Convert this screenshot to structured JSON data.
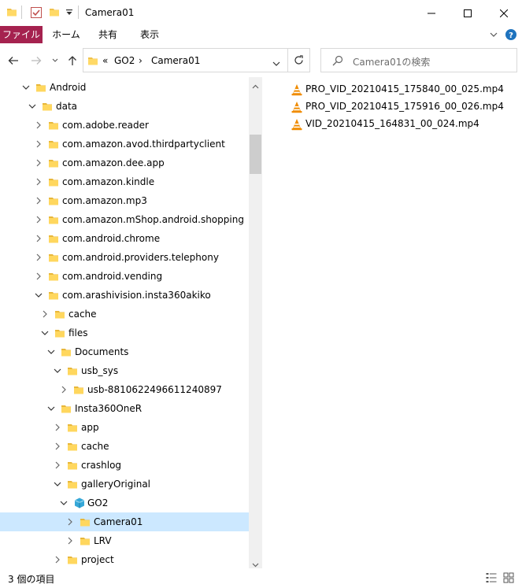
{
  "window": {
    "title": "Camera01",
    "minimize_glyph": "—",
    "maximize_glyph": "☐",
    "close_glyph": "✕"
  },
  "ribbon": {
    "tabs": [
      "ファイル",
      "ホーム",
      "共有",
      "表示"
    ],
    "expand_glyph": "∨",
    "help_glyph": "?"
  },
  "address": {
    "back_glyph": "←",
    "forward_glyph": "→",
    "recent_glyph": "∨",
    "up_glyph": "↑",
    "overflow": "«",
    "crumbs": [
      "GO2",
      "Camera01"
    ],
    "separator": "›",
    "dropdown_glyph": "∨",
    "refresh_glyph": "↻",
    "search_placeholder": "Camera01の検索"
  },
  "tree": [
    {
      "label": "Android",
      "depth": 0,
      "expanded": true,
      "icon": "folder-icon"
    },
    {
      "label": "data",
      "depth": 1,
      "expanded": true,
      "icon": "folder-icon"
    },
    {
      "label": "com.adobe.reader",
      "depth": 2,
      "expanded": false,
      "icon": "folder-icon"
    },
    {
      "label": "com.amazon.avod.thirdpartyclient",
      "depth": 2,
      "expanded": false,
      "icon": "folder-icon"
    },
    {
      "label": "com.amazon.dee.app",
      "depth": 2,
      "expanded": false,
      "icon": "folder-icon"
    },
    {
      "label": "com.amazon.kindle",
      "depth": 2,
      "expanded": false,
      "icon": "folder-icon"
    },
    {
      "label": "com.amazon.mp3",
      "depth": 2,
      "expanded": false,
      "icon": "folder-icon"
    },
    {
      "label": "com.amazon.mShop.android.shopping",
      "depth": 2,
      "expanded": false,
      "icon": "folder-icon"
    },
    {
      "label": "com.android.chrome",
      "depth": 2,
      "expanded": false,
      "icon": "folder-icon"
    },
    {
      "label": "com.android.providers.telephony",
      "depth": 2,
      "expanded": false,
      "icon": "folder-icon"
    },
    {
      "label": "com.android.vending",
      "depth": 2,
      "expanded": false,
      "icon": "folder-icon"
    },
    {
      "label": "com.arashivision.insta360akiko",
      "depth": 2,
      "expanded": true,
      "icon": "folder-icon"
    },
    {
      "label": "cache",
      "depth": 3,
      "expanded": false,
      "icon": "folder-icon"
    },
    {
      "label": "files",
      "depth": 3,
      "expanded": true,
      "icon": "folder-icon"
    },
    {
      "label": "Documents",
      "depth": 4,
      "expanded": true,
      "icon": "folder-icon"
    },
    {
      "label": "usb_sys",
      "depth": 5,
      "expanded": true,
      "icon": "folder-icon"
    },
    {
      "label": "usb-8810622496611240897",
      "depth": 6,
      "expanded": false,
      "icon": "folder-icon"
    },
    {
      "label": "Insta360OneR",
      "depth": 4,
      "expanded": true,
      "icon": "folder-icon"
    },
    {
      "label": "app",
      "depth": 5,
      "expanded": false,
      "icon": "folder-icon"
    },
    {
      "label": "cache",
      "depth": 5,
      "expanded": false,
      "icon": "folder-icon"
    },
    {
      "label": "crashlog",
      "depth": 5,
      "expanded": false,
      "icon": "folder-icon"
    },
    {
      "label": "galleryOriginal",
      "depth": 5,
      "expanded": true,
      "icon": "folder-icon"
    },
    {
      "label": "GO2",
      "depth": 6,
      "expanded": true,
      "icon": "3d-object-folder-icon"
    },
    {
      "label": "Camera01",
      "depth": 7,
      "expanded": false,
      "icon": "folder-icon",
      "selected": true
    },
    {
      "label": "LRV",
      "depth": 7,
      "expanded": false,
      "icon": "folder-icon"
    },
    {
      "label": "project",
      "depth": 5,
      "expanded": false,
      "icon": "folder-icon"
    }
  ],
  "files": [
    {
      "name": "PRO_VID_20210415_175840_00_025.mp4",
      "icon": "vlc-cone-icon"
    },
    {
      "name": "PRO_VID_20210415_175916_00_026.mp4",
      "icon": "vlc-cone-icon"
    },
    {
      "name": "VID_20210415_164831_00_024.mp4",
      "icon": "vlc-cone-icon"
    }
  ],
  "status": {
    "item_count": "3 個の項目"
  },
  "colors": {
    "file_tab": "#a5224f",
    "selection": "#cce8ff",
    "folder": "#f0c24c",
    "vlc_orange": "#f08c00"
  }
}
